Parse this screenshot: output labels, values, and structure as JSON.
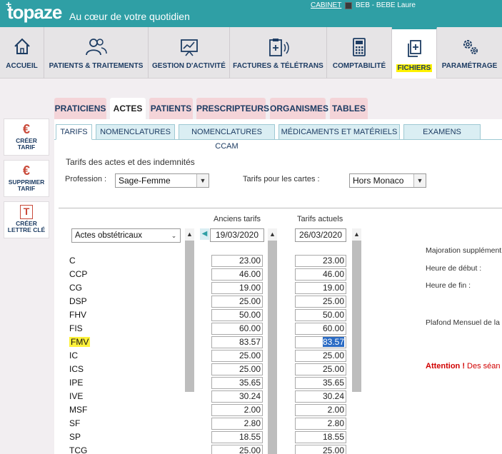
{
  "header": {
    "logo": "topaze",
    "tagline": "Au cœur de votre quotidien",
    "cabinet": "CABINET",
    "user": "BEB - BEBE Laure"
  },
  "nav": [
    {
      "label": "ACCUEIL",
      "icon": "home-icon"
    },
    {
      "label": "PATIENTS & TRAITEMENTS",
      "icon": "users-icon"
    },
    {
      "label": "GESTION D'ACTIVITÉ",
      "icon": "chart-board-icon"
    },
    {
      "label": "FACTURES & TÉLÉTRANS",
      "icon": "clipboard-signal-icon"
    },
    {
      "label": "COMPTABILITÉ",
      "icon": "calculator-icon"
    },
    {
      "label": "FICHIERS",
      "icon": "files-icon"
    },
    {
      "label": "PARAMÉTRAGE",
      "icon": "gears-icon"
    }
  ],
  "sidebar": [
    {
      "line1": "CRÉER",
      "line2": "TARIF",
      "icon": "euro-add-icon",
      "glyph": "€"
    },
    {
      "line1": "SUPPRIMER",
      "line2": "TARIF",
      "icon": "euro-delete-icon",
      "glyph": "€"
    },
    {
      "line1": "CRÉER",
      "line2": "LETTRE CLÉ",
      "icon": "letter-key-icon",
      "glyph": "T"
    }
  ],
  "tabs1": [
    "PRATICIENS",
    "ACTES",
    "PATIENTS",
    "PRESCRIPTEURS",
    "ORGANISMES",
    "TABLES"
  ],
  "tabs2": [
    "TARIFS",
    "NOMENCLATURES",
    "NOMENCLATURES CCAM",
    "MÉDICAMENTS ET MATÉRIELS",
    "EXAMENS"
  ],
  "section_title": "Tarifs des actes et des indemnités",
  "profession": {
    "label": "Profession :",
    "value": "Sage-Femme"
  },
  "cartes": {
    "label": "Tarifs pour les cartes :",
    "value": "Hors Monaco"
  },
  "category": "Actes obstétricaux",
  "anciens": {
    "header": "Anciens tarifs",
    "date": "19/03/2020"
  },
  "actuels": {
    "header": "Tarifs actuels",
    "date": "26/03/2020"
  },
  "rows": [
    {
      "code": "C",
      "old": "23.00",
      "new": "23.00"
    },
    {
      "code": "CCP",
      "old": "46.00",
      "new": "46.00"
    },
    {
      "code": "CG",
      "old": "19.00",
      "new": "19.00"
    },
    {
      "code": "DSP",
      "old": "25.00",
      "new": "25.00"
    },
    {
      "code": "FHV",
      "old": "50.00",
      "new": "50.00"
    },
    {
      "code": "FIS",
      "old": "60.00",
      "new": "60.00"
    },
    {
      "code": "FMV",
      "old": "83.57",
      "new": "83.57"
    },
    {
      "code": "IC",
      "old": "25.00",
      "new": "25.00"
    },
    {
      "code": "ICS",
      "old": "25.00",
      "new": "25.00"
    },
    {
      "code": "IPE",
      "old": "35.65",
      "new": "35.65"
    },
    {
      "code": "IVE",
      "old": "30.24",
      "new": "30.24"
    },
    {
      "code": "MSF",
      "old": "2.00",
      "new": "2.00"
    },
    {
      "code": "SF",
      "old": "2.80",
      "new": "2.80"
    },
    {
      "code": "SP",
      "old": "18.55",
      "new": "18.55"
    },
    {
      "code": "TCG",
      "old": "25.00",
      "new": "25.00"
    }
  ],
  "right_labels": [
    "Majoration supplément",
    "Heure de début :",
    "Heure de fin :",
    "Plafond Mensuel de la"
  ],
  "attention": {
    "bold": "Attention !",
    "text": "Des séan"
  }
}
